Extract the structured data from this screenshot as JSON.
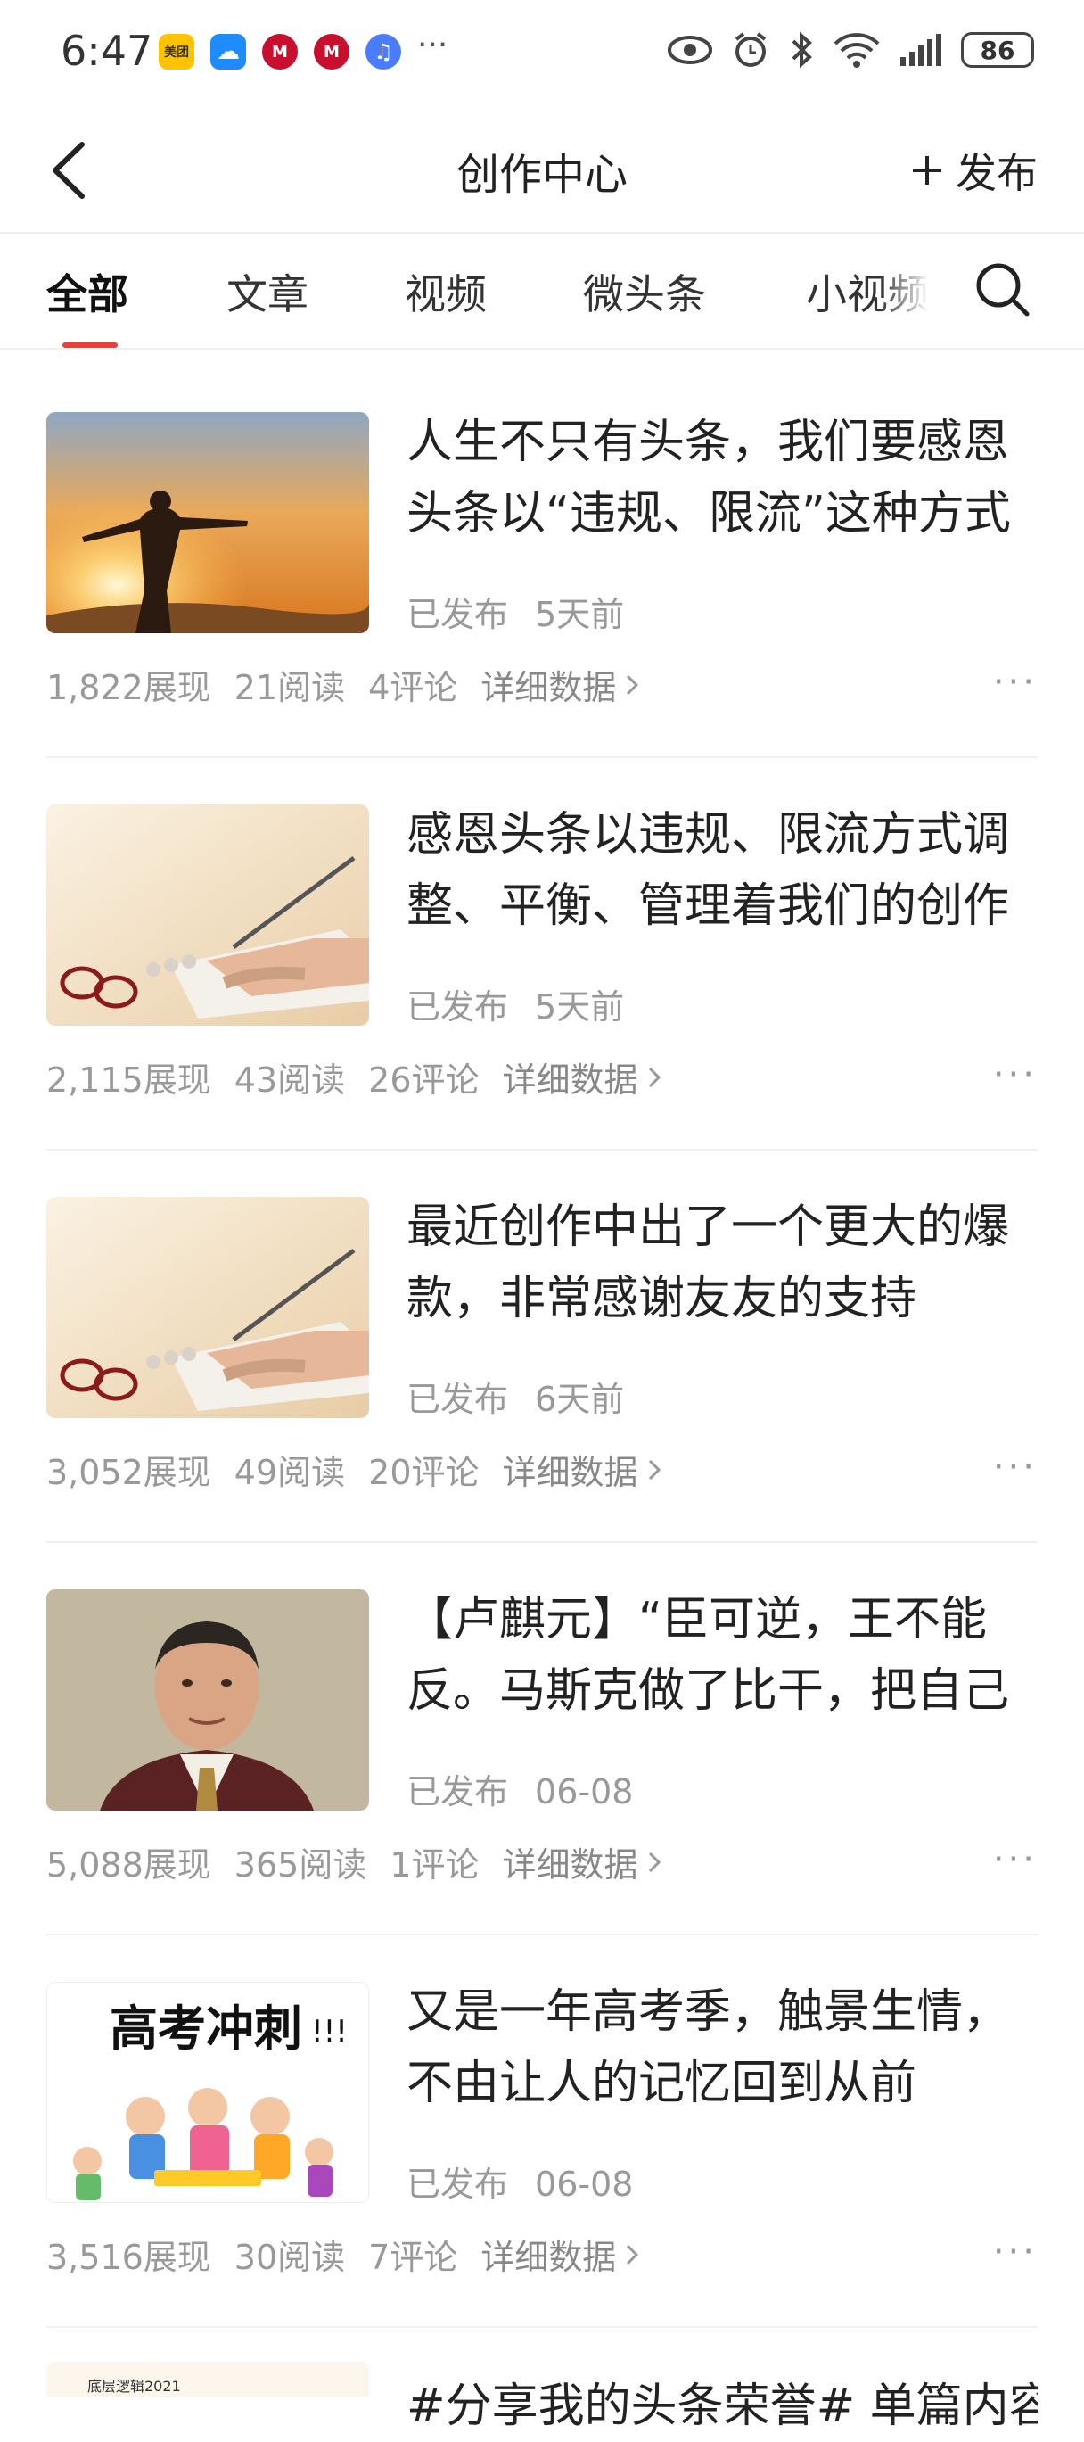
{
  "status_bar": {
    "time": "6:47",
    "app_icons": [
      {
        "name": "meituan-icon",
        "label": "美团",
        "color": "#ffc300"
      },
      {
        "name": "cloud-icon",
        "label": "☁",
        "color": "#1e8bff"
      },
      {
        "name": "metro-icon",
        "label": "M",
        "color": "#c8102e"
      },
      {
        "name": "metro-icon-2",
        "label": "M",
        "color": "#c8102e"
      },
      {
        "name": "music-icon",
        "label": "♫",
        "color": "#4a7cff"
      }
    ],
    "more": "···",
    "battery": "86"
  },
  "nav": {
    "title": "创作中心",
    "publish_label": "发布"
  },
  "tabs": [
    {
      "label": "全部",
      "active": true
    },
    {
      "label": "文章",
      "active": false
    },
    {
      "label": "视频",
      "active": false
    },
    {
      "label": "微头条",
      "active": false
    },
    {
      "label": "小视频",
      "active": false
    }
  ],
  "articles": [
    {
      "title": "人生不只有头条，我们要感恩头条以“违规、限流”这种方式",
      "status": "已发布",
      "time": "5天前",
      "views": "1,822展现",
      "reads": "21阅读",
      "comments": "4评论",
      "detail": "详细数据"
    },
    {
      "title": "感恩头条以违规、限流方式调整、平衡、管理着我们的创作",
      "status": "已发布",
      "time": "5天前",
      "views": "2,115展现",
      "reads": "43阅读",
      "comments": "26评论",
      "detail": "详细数据"
    },
    {
      "title": "最近创作中出了一个更大的爆款，非常感谢友友的支持",
      "status": "已发布",
      "time": "6天前",
      "views": "3,052展现",
      "reads": "49阅读",
      "comments": "20评论",
      "detail": "详细数据"
    },
    {
      "title": "【卢麒元】“臣可逆，王不能反。马斯克做了比干，把自己",
      "status": "已发布",
      "time": "06-08",
      "views": "5,088展现",
      "reads": "365阅读",
      "comments": "1评论",
      "detail": "详细数据"
    },
    {
      "title": "又是一年高考季，触景生情，不由让人的记忆回到从前",
      "status": "已发布",
      "time": "06-08",
      "views": "3,516展现",
      "reads": "30阅读",
      "comments": "7评论",
      "detail": "详细数据"
    }
  ],
  "thumb_text": {
    "gaokao": "高考冲刺",
    "gaokao_marks": "!!!",
    "peek_caption": "底层逻辑2021"
  },
  "peek_title": "#分享我的头条荣誉# 单篇内容"
}
